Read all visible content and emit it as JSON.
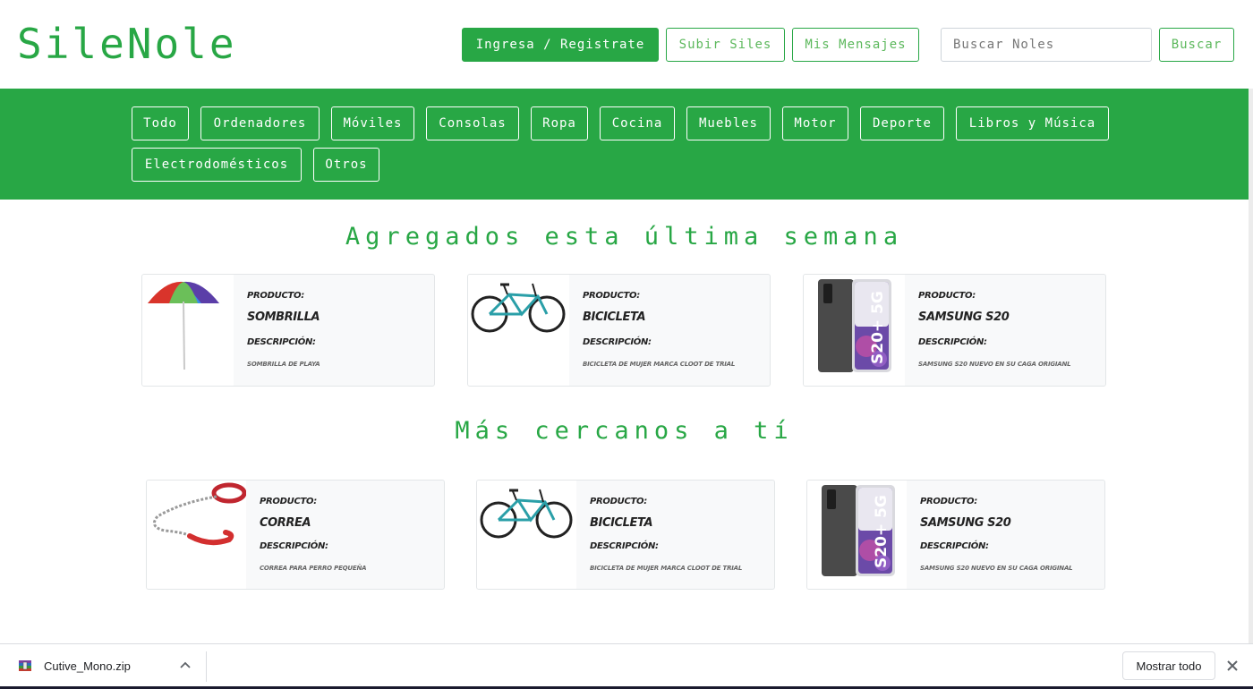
{
  "header": {
    "logo": "SileNole",
    "login_label": "Ingresa / Registrate",
    "upload_label": "Subir Siles",
    "messages_label": "Mis Mensajes",
    "search_placeholder": "Buscar Noles",
    "search_label": "Buscar"
  },
  "categories": [
    "Todo",
    "Ordenadores",
    "Móviles",
    "Consolas",
    "Ropa",
    "Cocina",
    "Muebles",
    "Motor",
    "Deporte",
    "Libros y Música",
    "Electrodomésticos",
    "Otros"
  ],
  "sections": [
    {
      "title": "Agregados esta última semana",
      "cards": [
        {
          "image_icon": "umbrella-icon",
          "product_label": "PRODUCTO:",
          "name": "SOMBRILLA",
          "description_label": "DESCRIPCIÓN:",
          "description": "SOMBRILLA DE PLAYA"
        },
        {
          "image_icon": "bicycle-icon",
          "product_label": "PRODUCTO:",
          "name": "BICICLETA",
          "description_label": "DESCRIPCIÓN:",
          "description": "BICICLETA DE MUJER MARCA CLOOT DE TRIAL"
        },
        {
          "image_icon": "phone-icon",
          "product_label": "PRODUCTO:",
          "name": "SAMSUNG S20",
          "description_label": "DESCRIPCIÓN:",
          "description": "SAMSUNG S20 NUEVO EN SU CAGA ORIGIANL"
        }
      ]
    },
    {
      "title": "Más cercanos a tí",
      "cards": [
        {
          "image_icon": "dog-leash-icon",
          "product_label": "PRODUCTO:",
          "name": "CORREA",
          "description_label": "DESCRIPCIÓN:",
          "description": "CORREA PARA PERRO PEQUEÑA"
        },
        {
          "image_icon": "bicycle-icon",
          "product_label": "PRODUCTO:",
          "name": "BICICLETA",
          "description_label": "DESCRIPCIÓN:",
          "description": "BICICLETA DE MUJER MARCA CLOOT DE TRIAL"
        },
        {
          "image_icon": "phone-icon",
          "product_label": "PRODUCTO:",
          "name": "SAMSUNG S20",
          "description_label": "DESCRIPCIÓN:",
          "description": "SAMSUNG S20 NUEVO EN SU CAGA ORIGINAL"
        }
      ]
    }
  ],
  "phone_screen_text": "S20+ 5G",
  "download_bar": {
    "file_name": "Cutive_Mono.zip",
    "show_all_label": "Mostrar todo"
  },
  "colors": {
    "accent": "#28a745",
    "card_bg": "#f8f9fa"
  }
}
